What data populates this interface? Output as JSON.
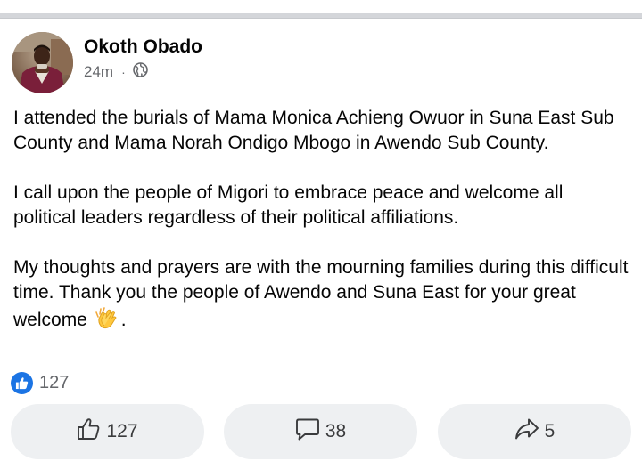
{
  "post": {
    "author": "Okoth Obado",
    "time": "24m",
    "separator": "·",
    "audience_icon": "globe-icon",
    "paragraphs": [
      "I attended the burials of Mama Monica Achieng Owuor in Suna East Sub County and Mama Norah Ondigo Mbogo in Awendo Sub County.",
      "I call upon the people of Migori to embrace peace and welcome all political leaders regardless of their political affiliations."
    ],
    "paragraph3_text": "My thoughts and prayers are with the mourning families during this difficult time. Thank you the people of Awendo and Suna East for your great welcome",
    "paragraph3_end": ".",
    "emoji": "clapping-hands"
  },
  "reactions": {
    "icon": "thumbs-up-icon",
    "count": "127"
  },
  "actions": {
    "like_count": "127",
    "comment_count": "38",
    "share_count": "5"
  },
  "colors": {
    "like_blue": "#1b74e4",
    "button_bg": "#eef0f2",
    "secondary_text": "#65676b"
  }
}
